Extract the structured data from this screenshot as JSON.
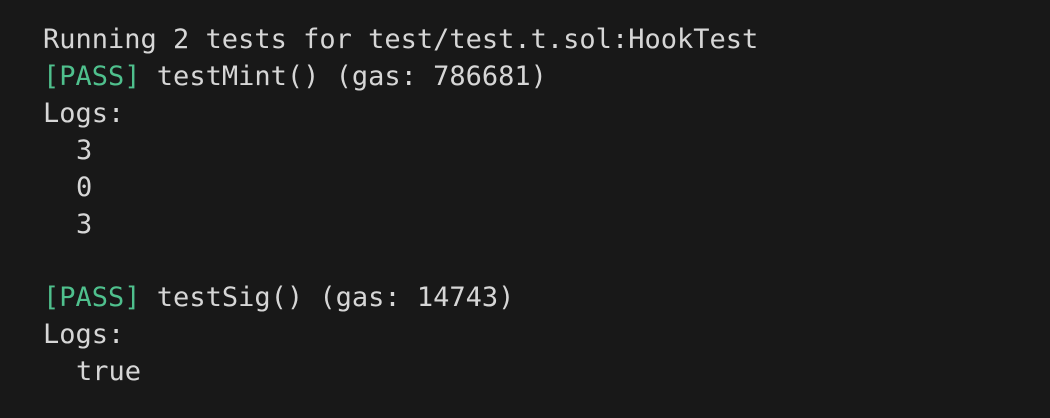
{
  "terminal": {
    "header": "Running 2 tests for test/test.t.sol:HookTest",
    "tests": [
      {
        "status": "[PASS]",
        "rest": " testMint() (gas: 786681)",
        "logs_label": "Logs:",
        "logs": [
          "3",
          "0",
          "3"
        ]
      },
      {
        "status": "[PASS]",
        "rest": " testSig() (gas: 14743)",
        "logs_label": "Logs:",
        "logs": [
          "true"
        ]
      }
    ]
  },
  "colors": {
    "background": "#181818",
    "text": "#d6d6d6",
    "pass": "#4fc08d"
  }
}
